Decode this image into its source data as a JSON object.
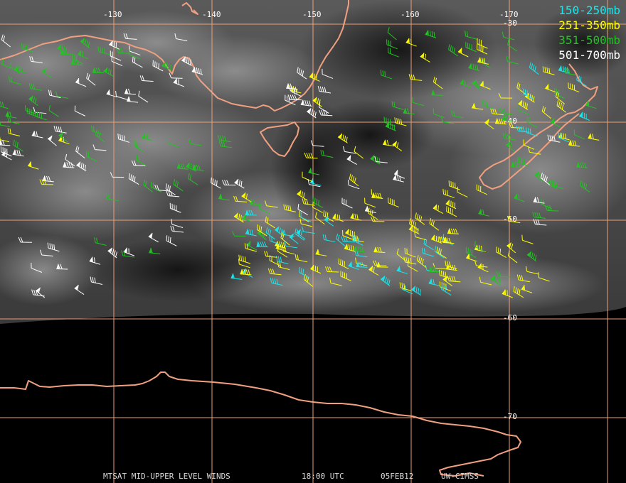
{
  "image": {
    "satellite_label": "MTSAT MID-UPPER LEVEL WINDS",
    "time_label": "18:00 UTC",
    "date_label": "05FEB12",
    "source_label": "UW-CIMSS"
  },
  "legend": [
    {
      "label": "150-250mb",
      "color": "#19e6ec"
    },
    {
      "label": "251-350mb",
      "color": "#ffff00"
    },
    {
      "label": "351-500mb",
      "color": "#22c422"
    },
    {
      "label": "501-700mb",
      "color": "#ffffff"
    }
  ],
  "longitude_ticks": [
    "-130",
    "-140",
    "-150",
    "-160",
    "-170"
  ],
  "latitude_ticks": [
    "-30",
    "-40",
    "-50",
    "-60",
    "-70"
  ],
  "colors": {
    "grid": "#e8a07a",
    "coast": "#f0a080",
    "cloud_base": "#4a4a4a",
    "space": "#000000"
  }
}
